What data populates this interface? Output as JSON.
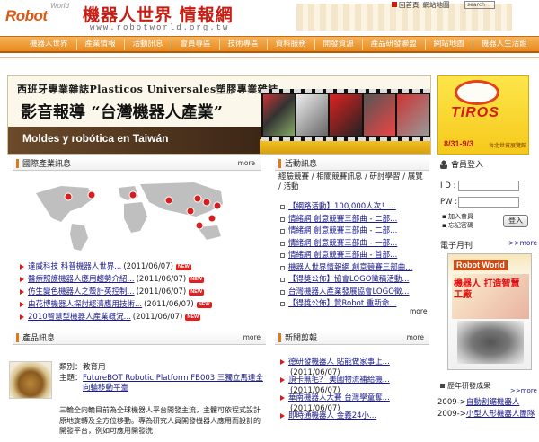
{
  "header": {
    "logo_text": "Robot",
    "logo_sub": "World",
    "site_title": "機器人世界 情報網",
    "site_url": "www.robotworld.org.tw",
    "top_links": [
      "回首頁",
      "網站地圖"
    ],
    "search_placeholder": "search"
  },
  "nav": {
    "items": [
      "機器人世界",
      "產業情報",
      "活動訊息",
      "會員專區",
      "技術專區",
      "資料服務",
      "開發資源",
      "產品研發聯盟",
      "網站地圖",
      "機器人生活館"
    ]
  },
  "banner": {
    "line1": "西班牙專業雜誌Plasticos Universales塑膠專業雜誌",
    "line2": "影音報導 “台灣機器人產業”",
    "strip": "Moldes y robótica en Taiwán",
    "side_logo": "TIROS",
    "side_date": "8/31-9/3",
    "side_place": "台北世貿展覽館"
  },
  "intl": {
    "title": "國際產業訊息",
    "more": "more",
    "items": [
      {
        "text": "達威科技 科普機器人世界...",
        "date": "(2011/06/07)",
        "new": "NEW"
      },
      {
        "text": "醫療照護機器人應用趨勢介紹...",
        "date": "(2011/06/07)",
        "new": "NEW"
      },
      {
        "text": "仿生變色機器人之殼計英控制...",
        "date": "(2011/06/07)",
        "new": "NEW"
      },
      {
        "text": "由花博機器人探討經濟應用技術...",
        "date": "(2011/06/07)",
        "new": "NEW"
      },
      {
        "text": "2010智慧型機器人產業概況...",
        "date": "(2011/06/07)",
        "new": "NEW"
      }
    ]
  },
  "activity": {
    "title": "活動訊息",
    "categories": "經驗競賽 / 相關競賽訊息 / 研討學習 / 展覽 / 活動",
    "items": [
      "【網路活動】100,000人次！...",
      "情緒網 創意競賽三部曲 - 二部...",
      "情緒網 創意競賽三部曲 - 二部...",
      "情緒網 創意競賽三部曲 - 一部...",
      "情緒網 創意競賽三部曲 - 首部...",
      "機器人世界情報網 創意競賽三部曲...",
      "【得獎公佈】協會LOGO徵稿活動...",
      "台灣機器人產業發展協會LOGO徵...",
      "【得獎公佈】贊Robot 重新命..."
    ],
    "more": "more"
  },
  "login": {
    "title": "會員登入",
    "id_label": "I D :",
    "pw_label": "PW :",
    "join": "加入會員",
    "forgot": "忘記密碼",
    "button": "登入"
  },
  "magazine": {
    "title": "電子月刊",
    "more": ">>more",
    "cover_title": "Robot World",
    "cover_headline": "機器人 打造智慧工廠"
  },
  "awards": {
    "title": "歷年研發成果",
    "more": ">>more",
    "items": [
      {
        "year": "2009->",
        "text": "自動割鋸機器人"
      },
      {
        "year": "2009->",
        "text": "小型人形機器人團隊"
      }
    ]
  },
  "product": {
    "title": "產品訊息",
    "more": "more",
    "category_key": "類別：",
    "category_val": "教育用",
    "subject_key": "主題：",
    "subject_val": "FutureBOT Robotic Platform FB003 三獨立馬達全向輪移動平臺",
    "desc": "三輪全向輪目前為全球機器人平台開發主流，主體可依程式設計原地旋轉及全方位移動。專為研究人員開發機器人應用而設計的開發平台，例如可應用開發洗"
  },
  "report": {
    "title": "新聞剪報",
    "more": "more",
    "items": [
      {
        "text": "德研發機器人 貼能做家事上...",
        "date": "(2011/06/07)"
      },
      {
        "text": "頂卡無毛？ 美國物流補給機...",
        "date": "(2011/06/07)"
      },
      {
        "text": "華南機器人大賽 台灣學童奪...",
        "date": "(2011/06/07)"
      },
      {
        "text": "即時通機器人 金義24小..."
      }
    ]
  },
  "colors": {
    "accent": "#e8891d",
    "brand_red": "#c81d12",
    "link": "#1a1a8c",
    "new_badge": "#e21f1f"
  }
}
